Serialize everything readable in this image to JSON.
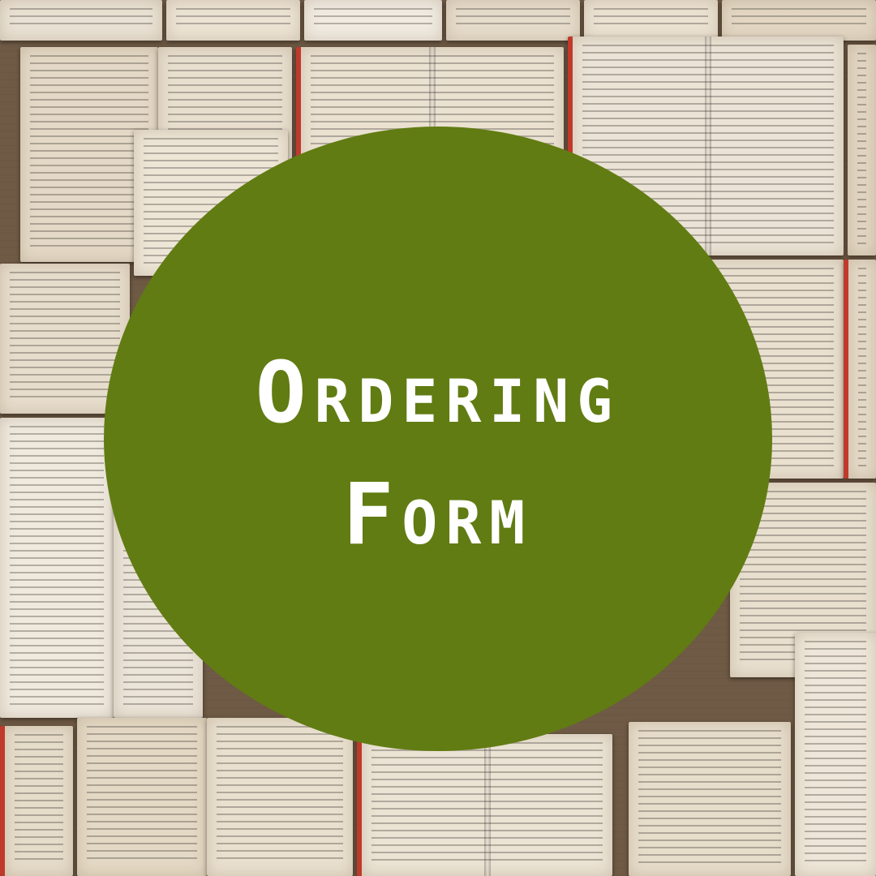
{
  "title_lines": [
    "Ordering",
    "Form"
  ],
  "colors": {
    "circle": "#617c12",
    "text": "#ffffff",
    "page": "#e8ddcc"
  }
}
